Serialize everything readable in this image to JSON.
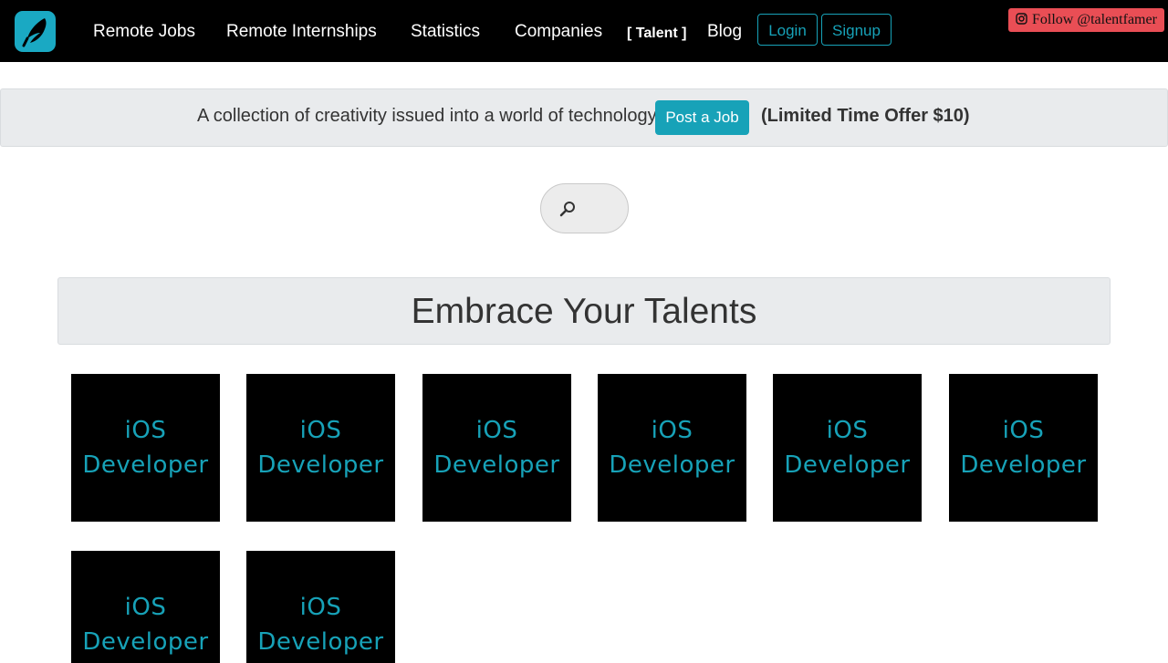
{
  "nav": {
    "logo": "talentfamer-logo",
    "links": [
      "Remote Jobs",
      "Remote Internships",
      "Statistics",
      "Companies",
      "[ Talent ]",
      "Blog"
    ],
    "login": "Login",
    "signup": "Signup",
    "follow": "Follow @talentfamer"
  },
  "banner": {
    "text": "A collection of creativity issued into a world of technology.",
    "post_job": "Post a Job",
    "offer": "(Limited Time Offer $10)"
  },
  "search": {
    "icon": "search-icon",
    "placeholder": ""
  },
  "heading": "Embrace Your Talents",
  "talents": [
    {
      "line1": "iOS",
      "line2": "Developer"
    },
    {
      "line1": "iOS",
      "line2": "Developer"
    },
    {
      "line1": "iOS",
      "line2": "Developer"
    },
    {
      "line1": "iOS",
      "line2": "Developer"
    },
    {
      "line1": "iOS",
      "line2": "Developer"
    },
    {
      "line1": "iOS",
      "line2": "Developer"
    },
    {
      "line1": "iOS",
      "line2": "Developer"
    },
    {
      "line1": "iOS",
      "line2": "Developer"
    }
  ],
  "colors": {
    "accent": "#17a2b8",
    "follow_bg": "#e94e55",
    "nav_bg": "#000000",
    "panel_bg": "#e9ebed"
  }
}
